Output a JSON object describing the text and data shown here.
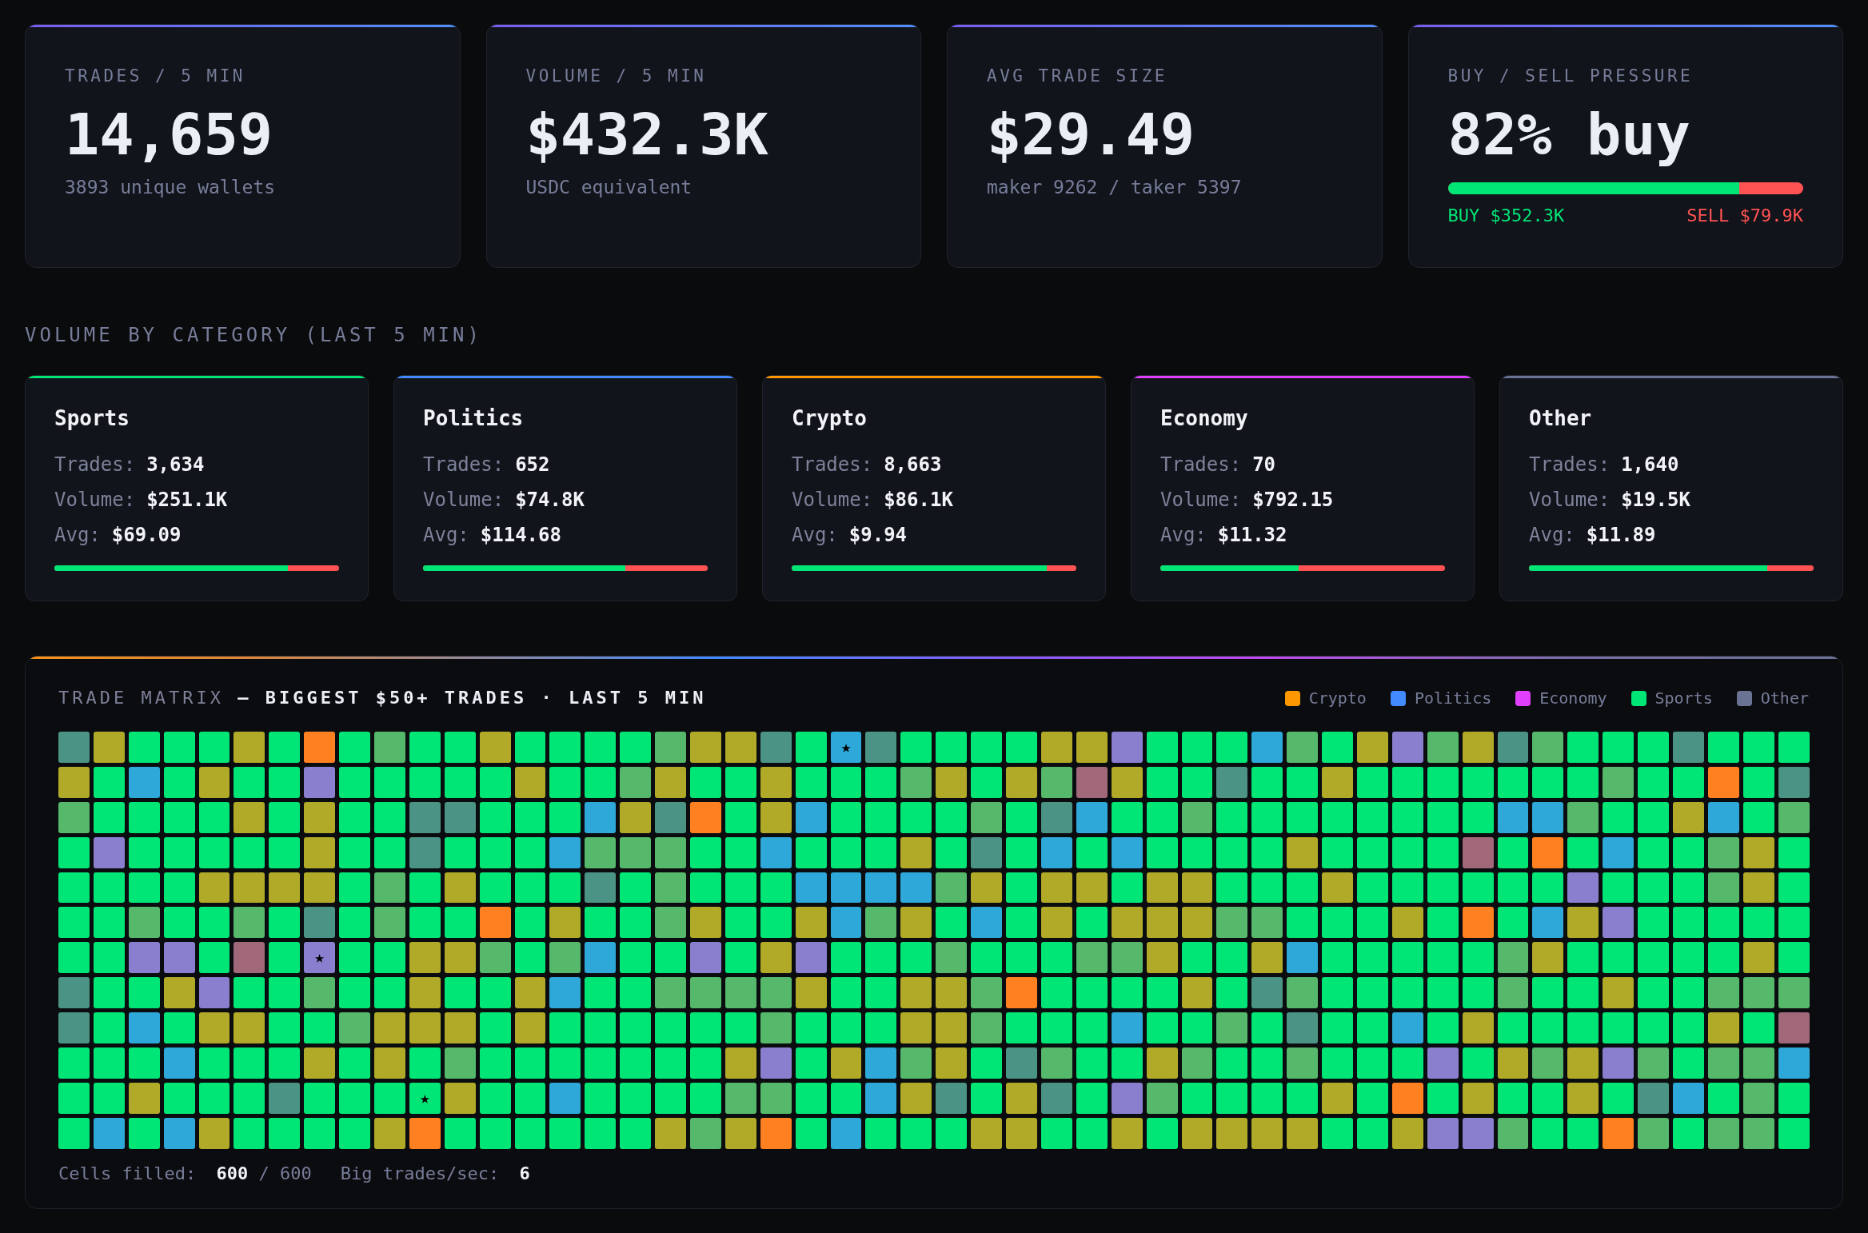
{
  "stats": [
    {
      "kind": "stat",
      "label": "TRADES / 5 MIN",
      "value": "14,659",
      "sub": "3893 unique wallets"
    },
    {
      "kind": "stat",
      "label": "VOLUME / 5 MIN",
      "value": "$432.3K",
      "sub": "USDC equivalent"
    },
    {
      "kind": "stat",
      "label": "AVG TRADE SIZE",
      "value": "$29.49",
      "sub": "maker 9262 / taker 5397"
    },
    {
      "kind": "pressure",
      "label": "BUY / SELL PRESSURE",
      "value": "82% buy",
      "level": 0.82,
      "buy": "BUY $352.3K",
      "sell": "SELL $79.9K"
    }
  ],
  "category_section": {
    "title": "VOLUME BY CATEGORY (LAST 5 MIN)",
    "categories": [
      {
        "name": "Sports",
        "color": "#00e676",
        "rows": [
          {
            "label": "Trades:",
            "value": "3,634"
          },
          {
            "label": "Volume:",
            "value": "$251.1K"
          },
          {
            "label": "Avg:",
            "value": "$69.09"
          }
        ],
        "level": 0.82
      },
      {
        "name": "Politics",
        "color": "#448aff",
        "rows": [
          {
            "label": "Trades:",
            "value": "652"
          },
          {
            "label": "Volume:",
            "value": "$74.8K"
          },
          {
            "label": "Avg:",
            "value": "$114.68"
          }
        ],
        "level": 0.71
      },
      {
        "name": "Crypto",
        "color": "#ff9800",
        "rows": [
          {
            "label": "Trades:",
            "value": "8,663"
          },
          {
            "label": "Volume:",
            "value": "$86.1K"
          },
          {
            "label": "Avg:",
            "value": "$9.94"
          }
        ],
        "level": 0.895
      },
      {
        "name": "Economy",
        "color": "#e040fb",
        "rows": [
          {
            "label": "Trades:",
            "value": "70"
          },
          {
            "label": "Volume:",
            "value": "$792.15"
          },
          {
            "label": "Avg:",
            "value": "$11.32"
          }
        ],
        "level": 0.485
      },
      {
        "name": "Other",
        "color": "#6b7394",
        "rows": [
          {
            "label": "Trades:",
            "value": "1,640"
          },
          {
            "label": "Volume:",
            "value": "$19.5K"
          },
          {
            "label": "Avg:",
            "value": "$11.89"
          }
        ],
        "level": 0.837
      }
    ]
  },
  "matrix": {
    "title": "TRADE MATRIX **— BIGGEST $50+ TRADES · LAST 5 MIN**",
    "legend": [
      {
        "label": "Crypto",
        "color": "#ff9800"
      },
      {
        "label": "Politics",
        "color": "#448aff"
      },
      {
        "label": "Economy",
        "color": "#e040fb"
      },
      {
        "label": "Sports",
        "color": "#00e676"
      },
      {
        "label": "Other",
        "color": "#6b7394"
      }
    ],
    "cells": [
      {
        "color": "#4b9485"
      },
      {
        "color": "#b0aa28"
      },
      {
        "color": "#00e676"
      },
      {
        "color": "#00e676"
      },
      {
        "color": "#00e676"
      },
      {
        "color": "#b0aa28"
      },
      {
        "color": "#00e676"
      },
      {
        "color": "#ff8020"
      },
      {
        "color": "#00e676"
      },
      {
        "color": "#55b86a"
      },
      {
        "color": "#00e676"
      },
      {
        "color": "#00e676"
      },
      {
        "color": "#b0aa28"
      },
      {
        "color": "#00e676"
      },
      {
        "color": "#00e676"
      },
      {
        "color": "#00e676"
      },
      {
        "color": "#00e676"
      },
      {
        "color": "#55b86a"
      },
      {
        "color": "#b0aa28"
      },
      {
        "color": "#b0aa28"
      },
      {
        "color": "#4b9485"
      },
      {
        "color": "#00e676"
      },
      {
        "color": "#2ea8d8",
        "symbol": "★"
      },
      {
        "color": "#4b9485"
      },
      {
        "color": "#00e676"
      },
      {
        "color": "#00e676"
      },
      {
        "color": "#00e676"
      },
      {
        "color": "#00e676"
      },
      {
        "color": "#b0aa28"
      },
      {
        "color": "#b0aa28"
      },
      {
        "color": "#8a7fcf"
      },
      {
        "color": "#00e676"
      },
      {
        "color": "#00e676"
      },
      {
        "color": "#00e676"
      },
      {
        "color": "#2ea8d8"
      },
      {
        "color": "#55b86a"
      },
      {
        "color": "#00e676"
      },
      {
        "color": "#b0aa28"
      },
      {
        "color": "#8a7fcf"
      },
      {
        "color": "#55b86a"
      },
      {
        "color": "#b0aa28"
      },
      {
        "color": "#4b9485"
      },
      {
        "color": "#55b86a"
      },
      {
        "color": "#00e676"
      },
      {
        "color": "#00e676"
      },
      {
        "color": "#00e676"
      },
      {
        "color": "#4b9485"
      },
      {
        "color": "#00e676"
      },
      {
        "color": "#00e676"
      },
      {
        "color": "#00e676"
      },
      {
        "color": "#b0aa28"
      },
      {
        "color": "#00e676"
      },
      {
        "color": "#2ea8d8"
      },
      {
        "color": "#00e676"
      },
      {
        "color": "#b0aa28"
      },
      {
        "color": "#00e676"
      },
      {
        "color": "#00e676"
      },
      {
        "color": "#8a7fcf"
      },
      {
        "color": "#00e676"
      },
      {
        "color": "#00e676"
      },
      {
        "color": "#00e676"
      },
      {
        "color": "#00e676"
      },
      {
        "color": "#00e676"
      },
      {
        "color": "#b0aa28"
      },
      {
        "color": "#00e676"
      },
      {
        "color": "#00e676"
      },
      {
        "color": "#55b86a"
      },
      {
        "color": "#b0aa28"
      },
      {
        "color": "#00e676"
      },
      {
        "color": "#00e676"
      },
      {
        "color": "#b0aa28"
      },
      {
        "color": "#00e676"
      },
      {
        "color": "#00e676"
      },
      {
        "color": "#00e676"
      },
      {
        "color": "#55b86a"
      },
      {
        "color": "#b0aa28"
      },
      {
        "color": "#00e676"
      },
      {
        "color": "#b0aa28"
      },
      {
        "color": "#55b86a"
      },
      {
        "color": "#a06878"
      },
      {
        "color": "#b0aa28"
      },
      {
        "color": "#00e676"
      },
      {
        "color": "#00e676"
      },
      {
        "color": "#4b9485"
      },
      {
        "color": "#00e676"
      },
      {
        "color": "#00e676"
      },
      {
        "color": "#b0aa28"
      },
      {
        "color": "#00e676"
      },
      {
        "color": "#00e676"
      },
      {
        "color": "#00e676"
      },
      {
        "color": "#00e676"
      },
      {
        "color": "#00e676"
      },
      {
        "color": "#00e676"
      },
      {
        "color": "#00e676"
      },
      {
        "color": "#55b86a"
      },
      {
        "color": "#00e676"
      },
      {
        "color": "#00e676"
      },
      {
        "color": "#ff8020"
      },
      {
        "color": "#00e676"
      },
      {
        "color": "#4b9485"
      },
      {
        "color": "#55b86a"
      },
      {
        "color": "#00e676"
      },
      {
        "color": "#00e676"
      },
      {
        "color": "#00e676"
      },
      {
        "color": "#00e676"
      },
      {
        "color": "#b0aa28"
      },
      {
        "color": "#00e676"
      },
      {
        "color": "#b0aa28"
      },
      {
        "color": "#00e676"
      },
      {
        "color": "#00e676"
      },
      {
        "color": "#4b9485"
      },
      {
        "color": "#4b9485"
      },
      {
        "color": "#00e676"
      },
      {
        "color": "#00e676"
      },
      {
        "color": "#00e676"
      },
      {
        "color": "#2ea8d8"
      },
      {
        "color": "#b0aa28"
      },
      {
        "color": "#4b9485"
      },
      {
        "color": "#ff8020"
      },
      {
        "color": "#00e676"
      },
      {
        "color": "#b0aa28"
      },
      {
        "color": "#2ea8d8"
      },
      {
        "color": "#00e676"
      },
      {
        "color": "#00e676"
      },
      {
        "color": "#00e676"
      },
      {
        "color": "#00e676"
      },
      {
        "color": "#55b86a"
      },
      {
        "color": "#00e676"
      },
      {
        "color": "#4b9485"
      },
      {
        "color": "#2ea8d8"
      },
      {
        "color": "#00e676"
      },
      {
        "color": "#00e676"
      },
      {
        "color": "#55b86a"
      },
      {
        "color": "#00e676"
      },
      {
        "color": "#00e676"
      },
      {
        "color": "#00e676"
      },
      {
        "color": "#00e676"
      },
      {
        "color": "#00e676"
      },
      {
        "color": "#00e676"
      },
      {
        "color": "#00e676"
      },
      {
        "color": "#00e676"
      },
      {
        "color": "#2ea8d8"
      },
      {
        "color": "#2ea8d8"
      },
      {
        "color": "#55b86a"
      },
      {
        "color": "#00e676"
      },
      {
        "color": "#00e676"
      },
      {
        "color": "#b0aa28"
      },
      {
        "color": "#2ea8d8"
      },
      {
        "color": "#00e676"
      },
      {
        "color": "#55b86a"
      },
      {
        "color": "#00e676"
      },
      {
        "color": "#8a7fcf"
      },
      {
        "color": "#00e676"
      },
      {
        "color": "#00e676"
      },
      {
        "color": "#00e676"
      },
      {
        "color": "#00e676"
      },
      {
        "color": "#00e676"
      },
      {
        "color": "#b0aa28"
      },
      {
        "color": "#00e676"
      },
      {
        "color": "#00e676"
      },
      {
        "color": "#4b9485"
      },
      {
        "color": "#00e676"
      },
      {
        "color": "#00e676"
      },
      {
        "color": "#00e676"
      },
      {
        "color": "#2ea8d8"
      },
      {
        "color": "#55b86a"
      },
      {
        "color": "#55b86a"
      },
      {
        "color": "#55b86a"
      },
      {
        "color": "#00e676"
      },
      {
        "color": "#00e676"
      },
      {
        "color": "#2ea8d8"
      },
      {
        "color": "#00e676"
      },
      {
        "color": "#00e676"
      },
      {
        "color": "#00e676"
      },
      {
        "color": "#b0aa28"
      },
      {
        "color": "#00e676"
      },
      {
        "color": "#4b9485"
      },
      {
        "color": "#00e676"
      },
      {
        "color": "#2ea8d8"
      },
      {
        "color": "#00e676"
      },
      {
        "color": "#2ea8d8"
      },
      {
        "color": "#00e676"
      },
      {
        "color": "#00e676"
      },
      {
        "color": "#00e676"
      },
      {
        "color": "#00e676"
      },
      {
        "color": "#b0aa28"
      },
      {
        "color": "#00e676"
      },
      {
        "color": "#00e676"
      },
      {
        "color": "#00e676"
      },
      {
        "color": "#00e676"
      },
      {
        "color": "#a06878"
      },
      {
        "color": "#00e676"
      },
      {
        "color": "#ff8020"
      },
      {
        "color": "#00e676"
      },
      {
        "color": "#2ea8d8"
      },
      {
        "color": "#00e676"
      },
      {
        "color": "#00e676"
      },
      {
        "color": "#55b86a"
      },
      {
        "color": "#b0aa28"
      },
      {
        "color": "#00e676"
      },
      {
        "color": "#00e676"
      },
      {
        "color": "#00e676"
      },
      {
        "color": "#00e676"
      },
      {
        "color": "#00e676"
      },
      {
        "color": "#b0aa28"
      },
      {
        "color": "#b0aa28"
      },
      {
        "color": "#b0aa28"
      },
      {
        "color": "#b0aa28"
      },
      {
        "color": "#00e676"
      },
      {
        "color": "#55b86a"
      },
      {
        "color": "#00e676"
      },
      {
        "color": "#b0aa28"
      },
      {
        "color": "#00e676"
      },
      {
        "color": "#00e676"
      },
      {
        "color": "#00e676"
      },
      {
        "color": "#4b9485"
      },
      {
        "color": "#00e676"
      },
      {
        "color": "#55b86a"
      },
      {
        "color": "#00e676"
      },
      {
        "color": "#00e676"
      },
      {
        "color": "#00e676"
      },
      {
        "color": "#2ea8d8"
      },
      {
        "color": "#2ea8d8"
      },
      {
        "color": "#2ea8d8"
      },
      {
        "color": "#2ea8d8"
      },
      {
        "color": "#55b86a"
      },
      {
        "color": "#b0aa28"
      },
      {
        "color": "#00e676"
      },
      {
        "color": "#b0aa28"
      },
      {
        "color": "#b0aa28"
      },
      {
        "color": "#00e676"
      },
      {
        "color": "#b0aa28"
      },
      {
        "color": "#b0aa28"
      },
      {
        "color": "#00e676"
      },
      {
        "color": "#00e676"
      },
      {
        "color": "#00e676"
      },
      {
        "color": "#b0aa28"
      },
      {
        "color": "#00e676"
      },
      {
        "color": "#00e676"
      },
      {
        "color": "#00e676"
      },
      {
        "color": "#00e676"
      },
      {
        "color": "#00e676"
      },
      {
        "color": "#00e676"
      },
      {
        "color": "#8a7fcf"
      },
      {
        "color": "#00e676"
      },
      {
        "color": "#00e676"
      },
      {
        "color": "#00e676"
      },
      {
        "color": "#55b86a"
      },
      {
        "color": "#b0aa28"
      },
      {
        "color": "#00e676"
      },
      {
        "color": "#00e676"
      },
      {
        "color": "#00e676"
      },
      {
        "color": "#55b86a"
      },
      {
        "color": "#00e676"
      },
      {
        "color": "#00e676"
      },
      {
        "color": "#55b86a"
      },
      {
        "color": "#00e676"
      },
      {
        "color": "#4b9485"
      },
      {
        "color": "#00e676"
      },
      {
        "color": "#55b86a"
      },
      {
        "color": "#00e676"
      },
      {
        "color": "#00e676"
      },
      {
        "color": "#ff8020"
      },
      {
        "color": "#00e676"
      },
      {
        "color": "#b0aa28"
      },
      {
        "color": "#00e676"
      },
      {
        "color": "#00e676"
      },
      {
        "color": "#55b86a"
      },
      {
        "color": "#b0aa28"
      },
      {
        "color": "#00e676"
      },
      {
        "color": "#00e676"
      },
      {
        "color": "#b0aa28"
      },
      {
        "color": "#2ea8d8"
      },
      {
        "color": "#55b86a"
      },
      {
        "color": "#b0aa28"
      },
      {
        "color": "#00e676"
      },
      {
        "color": "#2ea8d8"
      },
      {
        "color": "#00e676"
      },
      {
        "color": "#b0aa28"
      },
      {
        "color": "#00e676"
      },
      {
        "color": "#b0aa28"
      },
      {
        "color": "#b0aa28"
      },
      {
        "color": "#b0aa28"
      },
      {
        "color": "#55b86a"
      },
      {
        "color": "#55b86a"
      },
      {
        "color": "#00e676"
      },
      {
        "color": "#00e676"
      },
      {
        "color": "#00e676"
      },
      {
        "color": "#b0aa28"
      },
      {
        "color": "#00e676"
      },
      {
        "color": "#ff8020"
      },
      {
        "color": "#00e676"
      },
      {
        "color": "#2ea8d8"
      },
      {
        "color": "#b0aa28"
      },
      {
        "color": "#8a7fcf"
      },
      {
        "color": "#00e676"
      },
      {
        "color": "#00e676"
      },
      {
        "color": "#00e676"
      },
      {
        "color": "#00e676"
      },
      {
        "color": "#00e676"
      },
      {
        "color": "#00e676"
      },
      {
        "color": "#00e676"
      },
      {
        "color": "#8a7fcf"
      },
      {
        "color": "#8a7fcf"
      },
      {
        "color": "#00e676"
      },
      {
        "color": "#a06878"
      },
      {
        "color": "#00e676"
      },
      {
        "color": "#8a7fcf",
        "symbol": "★"
      },
      {
        "color": "#00e676"
      },
      {
        "color": "#00e676"
      },
      {
        "color": "#b0aa28"
      },
      {
        "color": "#b0aa28"
      },
      {
        "color": "#55b86a"
      },
      {
        "color": "#00e676"
      },
      {
        "color": "#55b86a"
      },
      {
        "color": "#2ea8d8"
      },
      {
        "color": "#00e676"
      },
      {
        "color": "#00e676"
      },
      {
        "color": "#8a7fcf"
      },
      {
        "color": "#00e676"
      },
      {
        "color": "#b0aa28"
      },
      {
        "color": "#8a7fcf"
      },
      {
        "color": "#00e676"
      },
      {
        "color": "#00e676"
      },
      {
        "color": "#00e676"
      },
      {
        "color": "#55b86a"
      },
      {
        "color": "#00e676"
      },
      {
        "color": "#00e676"
      },
      {
        "color": "#00e676"
      },
      {
        "color": "#55b86a"
      },
      {
        "color": "#55b86a"
      },
      {
        "color": "#b0aa28"
      },
      {
        "color": "#00e676"
      },
      {
        "color": "#00e676"
      },
      {
        "color": "#b0aa28"
      },
      {
        "color": "#2ea8d8"
      },
      {
        "color": "#00e676"
      },
      {
        "color": "#00e676"
      },
      {
        "color": "#00e676"
      },
      {
        "color": "#00e676"
      },
      {
        "color": "#00e676"
      },
      {
        "color": "#55b86a"
      },
      {
        "color": "#b0aa28"
      },
      {
        "color": "#00e676"
      },
      {
        "color": "#00e676"
      },
      {
        "color": "#00e676"
      },
      {
        "color": "#00e676"
      },
      {
        "color": "#00e676"
      },
      {
        "color": "#b0aa28"
      },
      {
        "color": "#00e676"
      },
      {
        "color": "#4b9485"
      },
      {
        "color": "#00e676"
      },
      {
        "color": "#00e676"
      },
      {
        "color": "#b0aa28"
      },
      {
        "color": "#8a7fcf"
      },
      {
        "color": "#00e676"
      },
      {
        "color": "#00e676"
      },
      {
        "color": "#55b86a"
      },
      {
        "color": "#00e676"
      },
      {
        "color": "#00e676"
      },
      {
        "color": "#b0aa28"
      },
      {
        "color": "#00e676"
      },
      {
        "color": "#00e676"
      },
      {
        "color": "#b0aa28"
      },
      {
        "color": "#2ea8d8"
      },
      {
        "color": "#00e676"
      },
      {
        "color": "#00e676"
      },
      {
        "color": "#55b86a"
      },
      {
        "color": "#55b86a"
      },
      {
        "color": "#55b86a"
      },
      {
        "color": "#55b86a"
      },
      {
        "color": "#b0aa28"
      },
      {
        "color": "#00e676"
      },
      {
        "color": "#00e676"
      },
      {
        "color": "#b0aa28"
      },
      {
        "color": "#b0aa28"
      },
      {
        "color": "#55b86a"
      },
      {
        "color": "#ff8020"
      },
      {
        "color": "#00e676"
      },
      {
        "color": "#00e676"
      },
      {
        "color": "#00e676"
      },
      {
        "color": "#00e676"
      },
      {
        "color": "#b0aa28"
      },
      {
        "color": "#00e676"
      },
      {
        "color": "#4b9485"
      },
      {
        "color": "#55b86a"
      },
      {
        "color": "#00e676"
      },
      {
        "color": "#00e676"
      },
      {
        "color": "#00e676"
      },
      {
        "color": "#00e676"
      },
      {
        "color": "#00e676"
      },
      {
        "color": "#55b86a"
      },
      {
        "color": "#00e676"
      },
      {
        "color": "#00e676"
      },
      {
        "color": "#b0aa28"
      },
      {
        "color": "#00e676"
      },
      {
        "color": "#00e676"
      },
      {
        "color": "#55b86a"
      },
      {
        "color": "#55b86a"
      },
      {
        "color": "#55b86a"
      },
      {
        "color": "#4b9485"
      },
      {
        "color": "#00e676"
      },
      {
        "color": "#2ea8d8"
      },
      {
        "color": "#00e676"
      },
      {
        "color": "#b0aa28"
      },
      {
        "color": "#b0aa28"
      },
      {
        "color": "#00e676"
      },
      {
        "color": "#00e676"
      },
      {
        "color": "#55b86a"
      },
      {
        "color": "#b0aa28"
      },
      {
        "color": "#b0aa28"
      },
      {
        "color": "#b0aa28"
      },
      {
        "color": "#00e676"
      },
      {
        "color": "#b0aa28"
      },
      {
        "color": "#00e676"
      },
      {
        "color": "#00e676"
      },
      {
        "color": "#00e676"
      },
      {
        "color": "#00e676"
      },
      {
        "color": "#00e676"
      },
      {
        "color": "#00e676"
      },
      {
        "color": "#55b86a"
      },
      {
        "color": "#00e676"
      },
      {
        "color": "#00e676"
      },
      {
        "color": "#00e676"
      },
      {
        "color": "#b0aa28"
      },
      {
        "color": "#b0aa28"
      },
      {
        "color": "#55b86a"
      },
      {
        "color": "#00e676"
      },
      {
        "color": "#00e676"
      },
      {
        "color": "#00e676"
      },
      {
        "color": "#2ea8d8"
      },
      {
        "color": "#00e676"
      },
      {
        "color": "#00e676"
      },
      {
        "color": "#55b86a"
      },
      {
        "color": "#00e676"
      },
      {
        "color": "#4b9485"
      },
      {
        "color": "#00e676"
      },
      {
        "color": "#00e676"
      },
      {
        "color": "#2ea8d8"
      },
      {
        "color": "#00e676"
      },
      {
        "color": "#b0aa28"
      },
      {
        "color": "#00e676"
      },
      {
        "color": "#00e676"
      },
      {
        "color": "#00e676"
      },
      {
        "color": "#00e676"
      },
      {
        "color": "#00e676"
      },
      {
        "color": "#00e676"
      },
      {
        "color": "#b0aa28"
      },
      {
        "color": "#00e676"
      },
      {
        "color": "#a06878"
      },
      {
        "color": "#00e676"
      },
      {
        "color": "#00e676"
      },
      {
        "color": "#00e676"
      },
      {
        "color": "#2ea8d8"
      },
      {
        "color": "#00e676"
      },
      {
        "color": "#00e676"
      },
      {
        "color": "#00e676"
      },
      {
        "color": "#b0aa28"
      },
      {
        "color": "#00e676"
      },
      {
        "color": "#b0aa28"
      },
      {
        "color": "#00e676"
      },
      {
        "color": "#55b86a"
      },
      {
        "color": "#00e676"
      },
      {
        "color": "#00e676"
      },
      {
        "color": "#00e676"
      },
      {
        "color": "#00e676"
      },
      {
        "color": "#00e676"
      },
      {
        "color": "#00e676"
      },
      {
        "color": "#00e676"
      },
      {
        "color": "#b0aa28"
      },
      {
        "color": "#8a7fcf"
      },
      {
        "color": "#00e676"
      },
      {
        "color": "#b0aa28"
      },
      {
        "color": "#2ea8d8"
      },
      {
        "color": "#55b86a"
      },
      {
        "color": "#b0aa28"
      },
      {
        "color": "#00e676"
      },
      {
        "color": "#4b9485"
      },
      {
        "color": "#55b86a"
      },
      {
        "color": "#00e676"
      },
      {
        "color": "#00e676"
      },
      {
        "color": "#b0aa28"
      },
      {
        "color": "#55b86a"
      },
      {
        "color": "#00e676"
      },
      {
        "color": "#00e676"
      },
      {
        "color": "#55b86a"
      },
      {
        "color": "#00e676"
      },
      {
        "color": "#00e676"
      },
      {
        "color": "#00e676"
      },
      {
        "color": "#8a7fcf"
      },
      {
        "color": "#00e676"
      },
      {
        "color": "#b0aa28"
      },
      {
        "color": "#55b86a"
      },
      {
        "color": "#b0aa28"
      },
      {
        "color": "#8a7fcf"
      },
      {
        "color": "#55b86a"
      },
      {
        "color": "#00e676"
      },
      {
        "color": "#55b86a"
      },
      {
        "color": "#55b86a"
      },
      {
        "color": "#2ea8d8"
      },
      {
        "color": "#00e676"
      },
      {
        "color": "#00e676"
      },
      {
        "color": "#b0aa28"
      },
      {
        "color": "#00e676"
      },
      {
        "color": "#00e676"
      },
      {
        "color": "#00e676"
      },
      {
        "color": "#4b9485"
      },
      {
        "color": "#00e676"
      },
      {
        "color": "#00e676"
      },
      {
        "color": "#00e676"
      },
      {
        "color": "#00e676",
        "symbol": "★"
      },
      {
        "color": "#b0aa28"
      },
      {
        "color": "#00e676"
      },
      {
        "color": "#00e676"
      },
      {
        "color": "#2ea8d8"
      },
      {
        "color": "#00e676"
      },
      {
        "color": "#00e676"
      },
      {
        "color": "#00e676"
      },
      {
        "color": "#00e676"
      },
      {
        "color": "#55b86a"
      },
      {
        "color": "#55b86a"
      },
      {
        "color": "#00e676"
      },
      {
        "color": "#00e676"
      },
      {
        "color": "#2ea8d8"
      },
      {
        "color": "#b0aa28"
      },
      {
        "color": "#4b9485"
      },
      {
        "color": "#00e676"
      },
      {
        "color": "#b0aa28"
      },
      {
        "color": "#4b9485"
      },
      {
        "color": "#00e676"
      },
      {
        "color": "#8a7fcf"
      },
      {
        "color": "#55b86a"
      },
      {
        "color": "#00e676"
      },
      {
        "color": "#00e676"
      },
      {
        "color": "#00e676"
      },
      {
        "color": "#00e676"
      },
      {
        "color": "#b0aa28"
      },
      {
        "color": "#00e676"
      },
      {
        "color": "#ff8020"
      },
      {
        "color": "#00e676"
      },
      {
        "color": "#b0aa28"
      },
      {
        "color": "#00e676"
      },
      {
        "color": "#00e676"
      },
      {
        "color": "#b0aa28"
      },
      {
        "color": "#00e676"
      },
      {
        "color": "#4b9485"
      },
      {
        "color": "#2ea8d8"
      },
      {
        "color": "#00e676"
      },
      {
        "color": "#55b86a"
      },
      {
        "color": "#00e676"
      },
      {
        "color": "#00e676"
      },
      {
        "color": "#2ea8d8"
      },
      {
        "color": "#00e676"
      },
      {
        "color": "#2ea8d8"
      },
      {
        "color": "#b0aa28"
      },
      {
        "color": "#00e676"
      },
      {
        "color": "#00e676"
      },
      {
        "color": "#00e676"
      },
      {
        "color": "#00e676"
      },
      {
        "color": "#b0aa28"
      },
      {
        "color": "#ff8020"
      },
      {
        "color": "#00e676"
      },
      {
        "color": "#00e676"
      },
      {
        "color": "#00e676"
      },
      {
        "color": "#00e676"
      },
      {
        "color": "#00e676"
      },
      {
        "color": "#00e676"
      },
      {
        "color": "#b0aa28"
      },
      {
        "color": "#55b86a"
      },
      {
        "color": "#b0aa28"
      },
      {
        "color": "#ff8020"
      },
      {
        "color": "#00e676"
      },
      {
        "color": "#2ea8d8"
      },
      {
        "color": "#00e676"
      },
      {
        "color": "#00e676"
      },
      {
        "color": "#00e676"
      },
      {
        "color": "#b0aa28"
      },
      {
        "color": "#b0aa28"
      },
      {
        "color": "#00e676"
      },
      {
        "color": "#00e676"
      },
      {
        "color": "#b0aa28"
      },
      {
        "color": "#00e676"
      },
      {
        "color": "#b0aa28"
      },
      {
        "color": "#b0aa28"
      },
      {
        "color": "#b0aa28"
      },
      {
        "color": "#b0aa28"
      },
      {
        "color": "#00e676"
      },
      {
        "color": "#00e676"
      },
      {
        "color": "#b0aa28"
      },
      {
        "color": "#8a7fcf"
      },
      {
        "color": "#8a7fcf"
      },
      {
        "color": "#55b86a"
      },
      {
        "color": "#00e676"
      },
      {
        "color": "#00e676"
      },
      {
        "color": "#ff8020"
      },
      {
        "color": "#55b86a"
      },
      {
        "color": "#00e676"
      },
      {
        "color": "#55b86a"
      },
      {
        "color": "#55b86a"
      },
      {
        "color": "#00e676"
      }
    ],
    "footer": [
      "Cells filled: **600** / 600",
      "Big trades/sec: **6**"
    ]
  }
}
